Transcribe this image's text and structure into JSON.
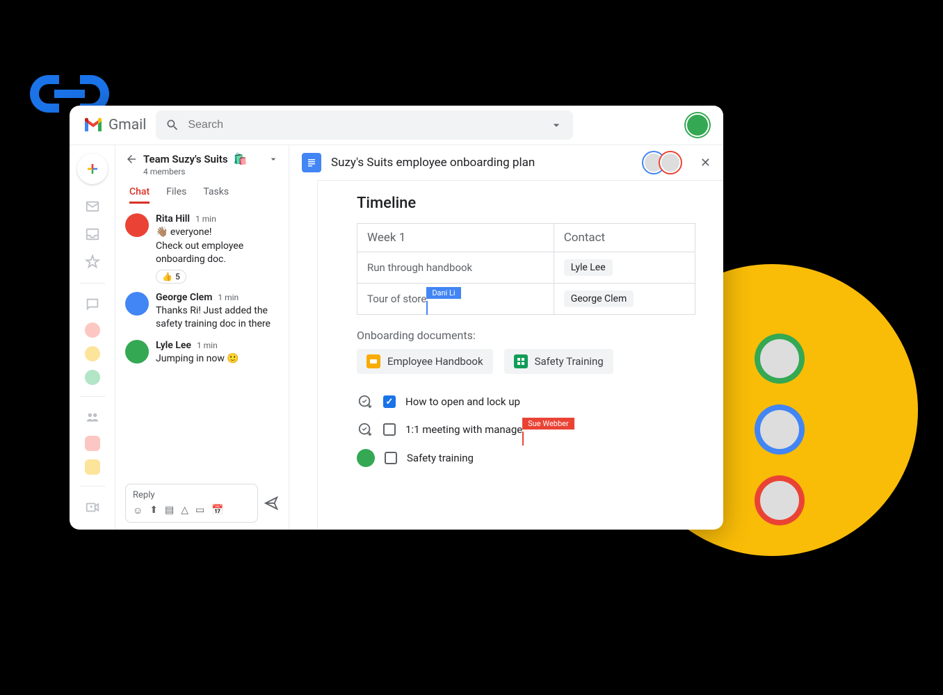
{
  "header": {
    "app_name": "Gmail",
    "search_placeholder": "Search",
    "avatar_color": "#34a853"
  },
  "rail": {
    "dots": [
      "#fcc7c2",
      "#fde49b",
      "#b2e5c6"
    ],
    "squares": [
      "#fcc7c2",
      "#fde49b"
    ]
  },
  "chat": {
    "space_name": "Team Suzy's Suits",
    "space_emoji": "🛍️",
    "members_text": "4 members",
    "tabs": [
      "Chat",
      "Files",
      "Tasks"
    ],
    "active_tab": 0,
    "messages": [
      {
        "author": "Rita Hill",
        "time": "1 min",
        "avatar_bg": "#ea4335",
        "text": "👋🏽 everyone!\nCheck out employee onboarding doc.",
        "reaction": {
          "emoji": "👍",
          "count": "5"
        }
      },
      {
        "author": "George Clem",
        "time": "1 min",
        "avatar_bg": "#4285f4",
        "text": "Thanks Ri! Just added the safety training doc in there"
      },
      {
        "author": "Lyle Lee",
        "time": "1 min",
        "avatar_bg": "#34a853",
        "text": "Jumping in now 🙂"
      }
    ],
    "reply_placeholder": "Reply"
  },
  "doc": {
    "title": "Suzy's Suits employee onboarding plan",
    "collaborator_avatars": [
      {
        "ring": "#4285f4"
      },
      {
        "ring": "#ea4335"
      }
    ],
    "section_title": "Timeline",
    "table": {
      "header": [
        "Week 1",
        "Contact"
      ],
      "rows": [
        {
          "task": "Run through handbook",
          "contact": "Lyle Lee"
        },
        {
          "task": "Tour of store",
          "contact": "George Clem",
          "cursor": {
            "name": "Dani Li",
            "color": "blue"
          }
        }
      ]
    },
    "onboarding_label": "Onboarding documents:",
    "doc_chips": [
      {
        "icon_bg": "#f9ab00",
        "icon_type": "slides",
        "label": "Employee Handbook"
      },
      {
        "icon_bg": "#0f9d58",
        "icon_type": "sheets",
        "label": "Safety Training"
      }
    ],
    "tasks": [
      {
        "checked": true,
        "assign_icon": true,
        "text": "How to open and lock up"
      },
      {
        "checked": false,
        "assign_icon": true,
        "text": "1:1 meeting with manage",
        "cursor": {
          "name": "Sue Webber",
          "color": "red"
        }
      },
      {
        "checked": false,
        "avatar_bg": "#34a853",
        "text": "Safety training"
      }
    ]
  },
  "floating_avatars": [
    {
      "bg": "#34a853"
    },
    {
      "bg": "#4285f4"
    },
    {
      "bg": "#ea4335"
    }
  ]
}
